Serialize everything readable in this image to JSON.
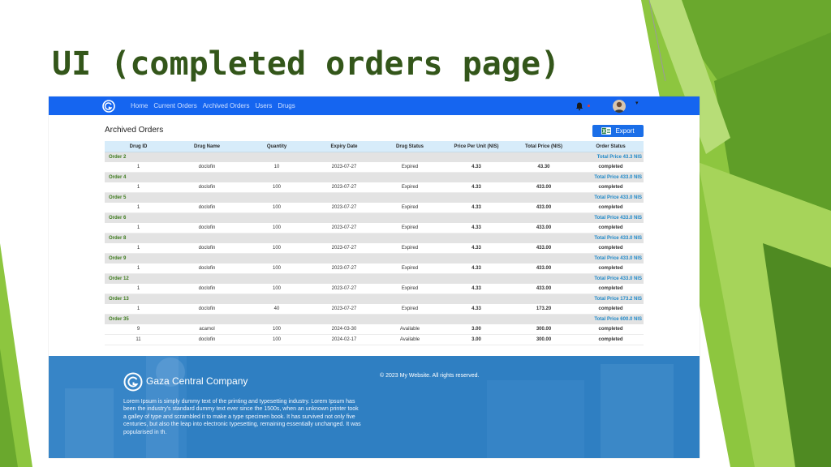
{
  "slide": {
    "title": "UI (completed orders page)",
    "accent_colors": [
      "#8dc63f",
      "#6aa82d",
      "#a6d45a",
      "#4f8a22"
    ]
  },
  "navbar": {
    "background": "#1565f0",
    "links": [
      "Home",
      "Current Orders",
      "Archived Orders",
      "Users",
      "Drugs"
    ]
  },
  "page": {
    "heading": "Archived Orders",
    "export_label": "Export"
  },
  "table": {
    "headers": [
      "Drug ID",
      "Drug Name",
      "Quantity",
      "Expiry Date",
      "Drug Status",
      "Price Per Unit (NIS)",
      "Total Price (NIS)",
      "Order Status"
    ],
    "orders": [
      {
        "label": "Order 2",
        "total": "Total Price 43.3 NIS",
        "items": [
          {
            "id": "1",
            "name": "doclofin",
            "qty": "10",
            "expiry": "2023-07-27",
            "status": "Expired",
            "ppu": "4.33",
            "total": "43.30",
            "order_status": "completed"
          }
        ]
      },
      {
        "label": "Order 4",
        "total": "Total Price 433.0 NIS",
        "items": [
          {
            "id": "1",
            "name": "doclofin",
            "qty": "100",
            "expiry": "2023-07-27",
            "status": "Expired",
            "ppu": "4.33",
            "total": "433.00",
            "order_status": "completed"
          }
        ]
      },
      {
        "label": "Order 5",
        "total": "Total Price 433.0 NIS",
        "items": [
          {
            "id": "1",
            "name": "doclofin",
            "qty": "100",
            "expiry": "2023-07-27",
            "status": "Expired",
            "ppu": "4.33",
            "total": "433.00",
            "order_status": "completed"
          }
        ]
      },
      {
        "label": "Order 6",
        "total": "Total Price 433.0 NIS",
        "items": [
          {
            "id": "1",
            "name": "doclofin",
            "qty": "100",
            "expiry": "2023-07-27",
            "status": "Expired",
            "ppu": "4.33",
            "total": "433.00",
            "order_status": "completed"
          }
        ]
      },
      {
        "label": "Order 8",
        "total": "Total Price 433.0 NIS",
        "items": [
          {
            "id": "1",
            "name": "doclofin",
            "qty": "100",
            "expiry": "2023-07-27",
            "status": "Expired",
            "ppu": "4.33",
            "total": "433.00",
            "order_status": "completed"
          }
        ]
      },
      {
        "label": "Order 9",
        "total": "Total Price 433.0 NIS",
        "items": [
          {
            "id": "1",
            "name": "doclofin",
            "qty": "100",
            "expiry": "2023-07-27",
            "status": "Expired",
            "ppu": "4.33",
            "total": "433.00",
            "order_status": "completed"
          }
        ]
      },
      {
        "label": "Order 12",
        "total": "Total Price 433.0 NIS",
        "items": [
          {
            "id": "1",
            "name": "doclofin",
            "qty": "100",
            "expiry": "2023-07-27",
            "status": "Expired",
            "ppu": "4.33",
            "total": "433.00",
            "order_status": "completed"
          }
        ]
      },
      {
        "label": "Order 13",
        "total": "Total Price 173.2 NIS",
        "items": [
          {
            "id": "1",
            "name": "doclofin",
            "qty": "40",
            "expiry": "2023-07-27",
            "status": "Expired",
            "ppu": "4.33",
            "total": "173.20",
            "order_status": "completed"
          }
        ]
      },
      {
        "label": "Order 35",
        "total": "Total Price 600.0 NIS",
        "items": [
          {
            "id": "9",
            "name": "acamol",
            "qty": "100",
            "expiry": "2024-03-30",
            "status": "Available",
            "ppu": "3.00",
            "total": "300.00",
            "order_status": "completed"
          },
          {
            "id": "11",
            "name": "doclofin",
            "qty": "100",
            "expiry": "2024-02-17",
            "status": "Available",
            "ppu": "3.00",
            "total": "300.00",
            "order_status": "completed"
          }
        ]
      }
    ]
  },
  "footer": {
    "company": "Gaza Central Company",
    "copyright": "© 2023 My Website. All rights reserved.",
    "description": "Lorem Ipsum is simply dummy text of the printing and typesetting industry. Lorem Ipsum has been the industry's standard dummy text ever since the 1500s, when an unknown printer took a galley of type and scrambled it to make a type specimen book. It has survived not only five centuries, but also the leap into electronic typesetting, remaining essentially unchanged. It was popularised in th."
  },
  "icons": [
    "app-logo-icon",
    "bell-icon",
    "avatar",
    "chevron-down-icon",
    "excel-icon"
  ]
}
